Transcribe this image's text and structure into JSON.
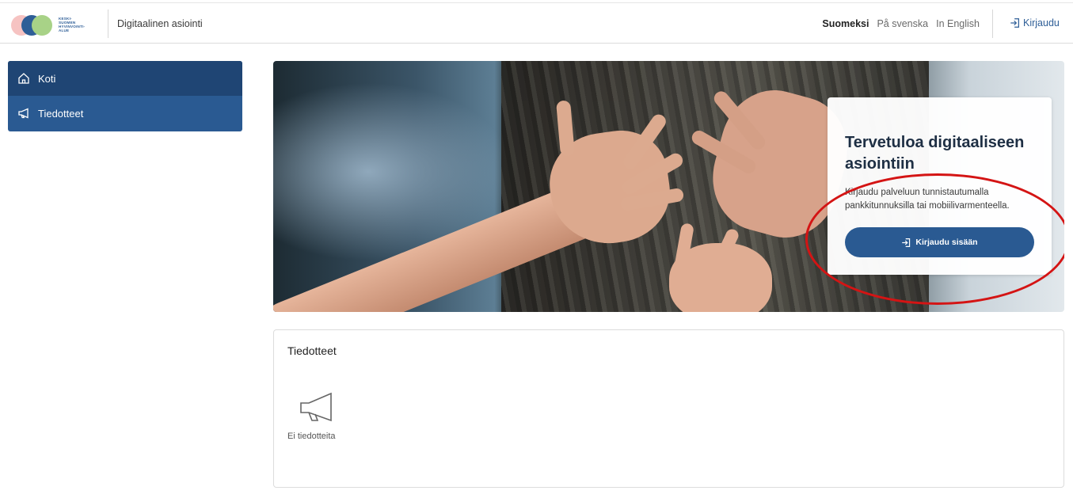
{
  "header": {
    "logo_text": "KESKI-\nSUOMEN\nHYVINVOINTI-\nALUE",
    "app_title": "Digitaalinen asiointi",
    "languages": [
      {
        "label": "Suomeksi",
        "active": true
      },
      {
        "label": "På svenska",
        "active": false
      },
      {
        "label": "In English",
        "active": false
      }
    ],
    "login_label": "Kirjaudu",
    "login_icon": "login-icon"
  },
  "sidebar": {
    "items": [
      {
        "label": "Koti",
        "icon": "home-icon",
        "active": true
      },
      {
        "label": "Tiedotteet",
        "icon": "megaphone-icon",
        "active": false
      }
    ]
  },
  "hero": {
    "title": "Tervetuloa digitaaliseen asiointiin",
    "description": "Kirjaudu palveluun tunnistautumalla pankkitunnuksilla tai mobiilivarmenteella.",
    "button_label": "Kirjaudu sisään",
    "button_icon": "login-icon"
  },
  "news": {
    "title": "Tiedotteet",
    "empty_icon": "megaphone-icon",
    "empty_text": "Ei tiedotteita"
  },
  "colors": {
    "primary": "#2a5a92",
    "sidebar_active": "#1f4574",
    "annotation": "#d41414"
  }
}
